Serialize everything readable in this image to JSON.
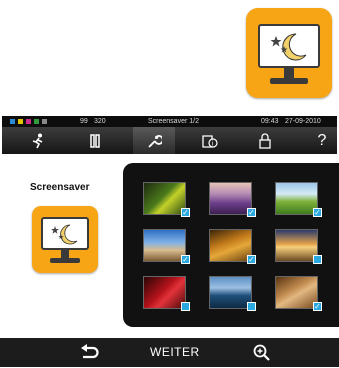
{
  "status_bar": {
    "left_value_1": "99",
    "left_value_2": "320",
    "center_text": "Screensaver 1/2",
    "time": "09:43",
    "date": "27-09-2010"
  },
  "toolbar": {
    "items": [
      {
        "icon": "runner-icon"
      },
      {
        "icon": "phone-icon"
      },
      {
        "icon": "wrench-icon"
      },
      {
        "icon": "document-info-icon"
      },
      {
        "icon": "lock-icon"
      },
      {
        "icon": "help-icon"
      }
    ],
    "help_label": "?"
  },
  "page": {
    "title": "Screensaver"
  },
  "gallery": {
    "thumbnails": [
      {
        "name": "frog on leaf",
        "checked": true
      },
      {
        "name": "lavender field",
        "checked": true
      },
      {
        "name": "green meadow",
        "checked": true
      },
      {
        "name": "tropical building",
        "checked": true
      },
      {
        "name": "autumn tree",
        "checked": true
      },
      {
        "name": "desert sunset",
        "checked": false
      },
      {
        "name": "red flower",
        "checked": false
      },
      {
        "name": "ocean cliffs",
        "checked": false
      },
      {
        "name": "sand dunes",
        "checked": true
      }
    ]
  },
  "bottom_bar": {
    "next_label": "WEITER"
  },
  "colors": {
    "accent": "#f7a514",
    "check_blue": "#2aa8e0"
  }
}
